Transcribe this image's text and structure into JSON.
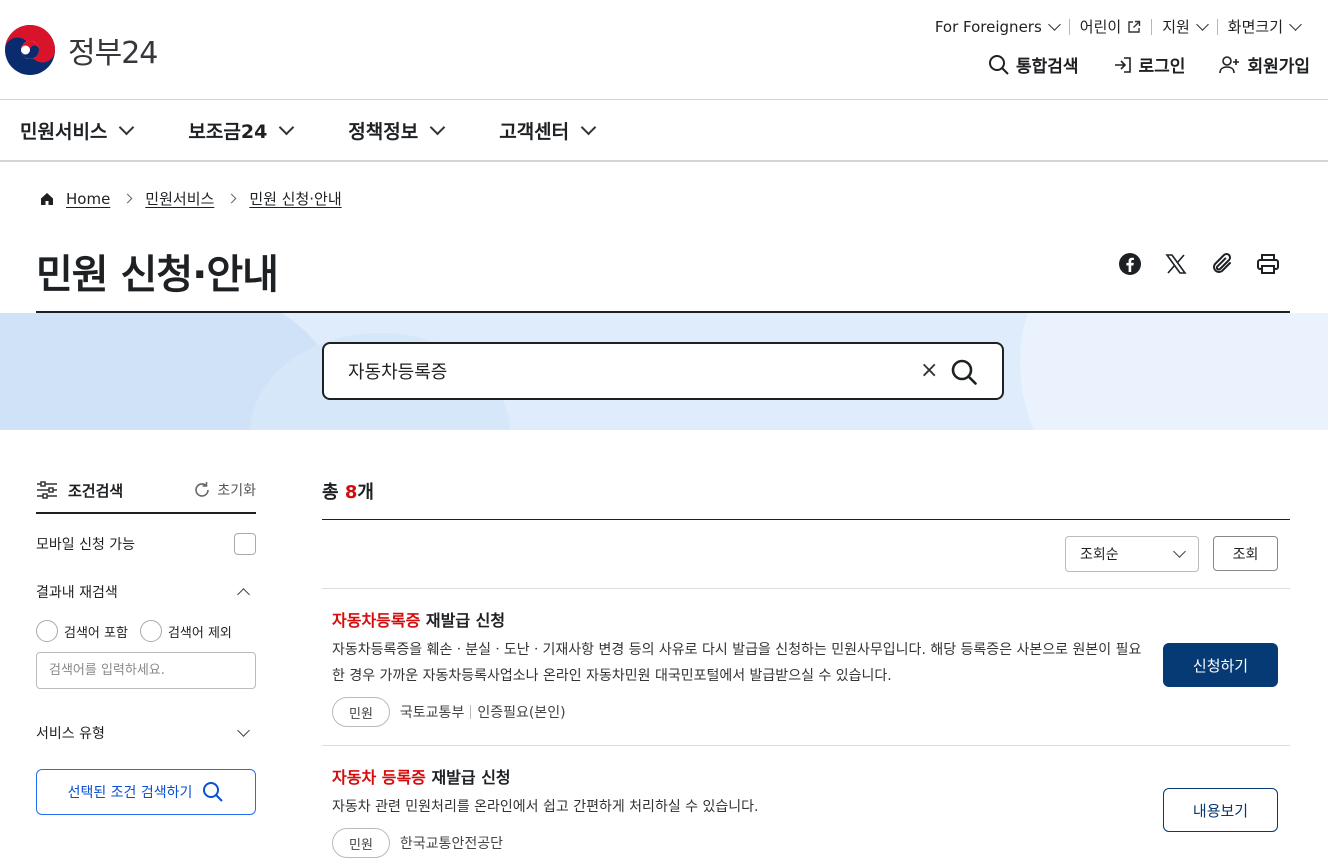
{
  "header": {
    "logo_text": "정부24",
    "util": [
      {
        "label": "For Foreigners",
        "icon": "chevron-down-icon"
      },
      {
        "label": "어린이",
        "icon": "external-link-icon"
      },
      {
        "label": "지원",
        "icon": "chevron-down-icon"
      },
      {
        "label": "화면크기",
        "icon": "chevron-down-icon"
      }
    ],
    "actions": [
      {
        "label": "통합검색",
        "icon": "search-icon"
      },
      {
        "label": "로그인",
        "icon": "login-icon"
      },
      {
        "label": "회원가입",
        "icon": "user-plus-icon"
      }
    ]
  },
  "nav": [
    {
      "label": "민원서비스"
    },
    {
      "label": "보조금24"
    },
    {
      "label": "정책정보"
    },
    {
      "label": "고객센터"
    }
  ],
  "breadcrumb": {
    "home": "Home",
    "level1": "민원서비스",
    "level2": "민원 신청·안내"
  },
  "page": {
    "title": "민원 신청·안내",
    "share_icons": [
      "facebook-icon",
      "x-icon",
      "paperclip-icon",
      "print-icon"
    ]
  },
  "search": {
    "value": "자동차등록증",
    "clear": "×"
  },
  "sidebar": {
    "title": "조건검색",
    "reset": "초기화",
    "mobile_label": "모바일 신청 가능",
    "refine_label": "결과내 재검색",
    "radio_include": "검색어 포함",
    "radio_exclude": "검색어 제외",
    "input_placeholder": "검색어를 입력하세요.",
    "service_type": "서비스 유형",
    "search_button": "선택된 조건 검색하기"
  },
  "results": {
    "count_prefix": "총 ",
    "count": "8",
    "count_suffix": "개",
    "sort_selected": "조회순",
    "sort_button": "조회",
    "items": [
      {
        "title_hl": "자동차등록증",
        "title_rest": " 재발급 신청",
        "desc": "자동차등록증을 훼손ㆍ분실ㆍ도난ㆍ기재사항 변경 등의 사유로 다시 발급을 신청하는 민원사무입니다. 해당 등록증은 사본으로 원본이 필요한 경우 가까운 자동차등록사업소나 온라인 자동차민원 대국민포털에서 발급받으실 수 있습니다.",
        "tag": "민원",
        "org": "국토교통부",
        "auth": "인증필요(본인)",
        "button": "신청하기"
      },
      {
        "title_hl": "자동차 등록증",
        "title_rest": " 재발급 신청",
        "desc": "자동차 관련 민원처리를 온라인에서 쉽고 간편하게 처리하실 수 있습니다.",
        "tag": "민원",
        "org": "한국교통안전공단",
        "button": "내용보기"
      }
    ]
  },
  "colors": {
    "highlight": "#d50c0c",
    "primary_button": "#063a74",
    "search_band": "#dfecfb",
    "link_blue": "#256ef4"
  }
}
